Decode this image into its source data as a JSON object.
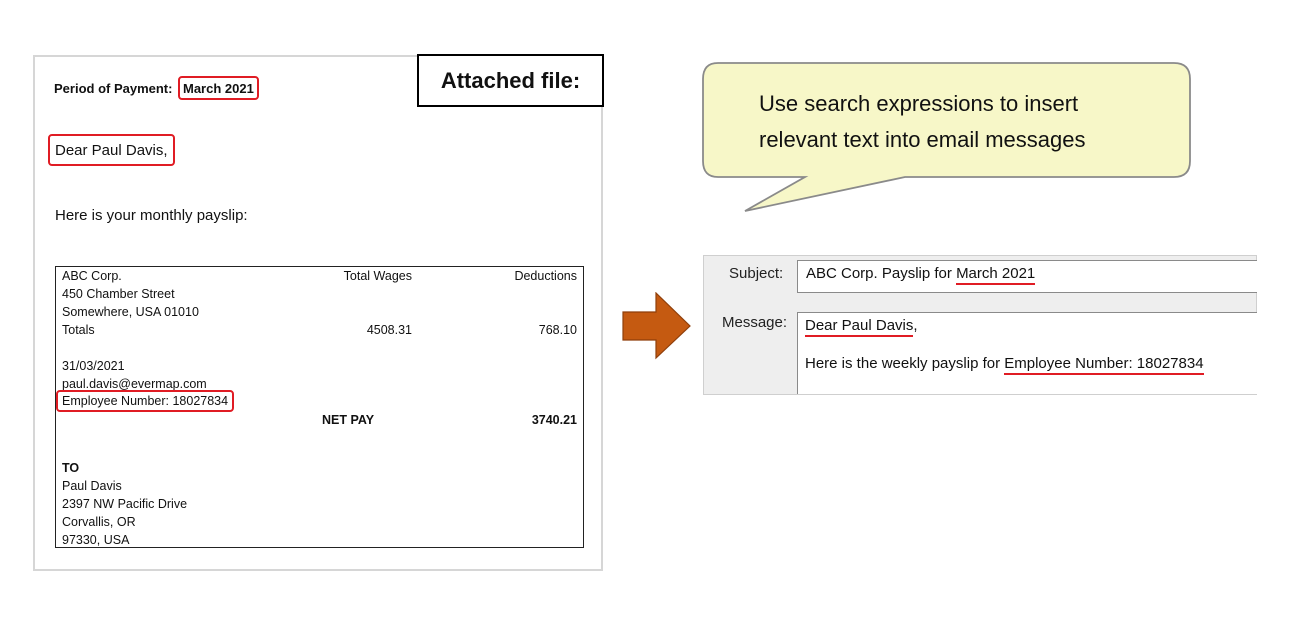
{
  "attached_label": "Attached file:",
  "document": {
    "period_label": "Period of Payment:",
    "period_value": "March 2021",
    "greeting": "Dear Paul Davis,",
    "intro": "Here is your monthly payslip:",
    "payslip": {
      "company": "ABC Corp.",
      "street": "450 Chamber Street",
      "city": "Somewhere, USA 01010",
      "totals_label": "Totals",
      "col_wages": "Total Wages",
      "col_deductions": "Deductions",
      "wages_total": "4508.31",
      "deductions_total": "768.10",
      "date": "31/03/2021",
      "email": "paul.davis@evermap.com",
      "employee_number": "Employee Number: 18027834",
      "net_pay_label": "NET PAY",
      "net_pay_value": "3740.21",
      "to_label": "TO",
      "to_name": "Paul Davis",
      "to_street": "2397 NW Pacific Drive",
      "to_city": "Corvallis, OR",
      "to_zip": "97330, USA"
    }
  },
  "callout": {
    "line1": "Use search expressions to insert",
    "line2": "relevant text into email messages"
  },
  "email": {
    "subject_label": "Subject:",
    "subject_prefix": "ABC Corp. Payslip for ",
    "subject_var": "March 2021",
    "message_label": "Message:",
    "msg_line1": "Dear Paul Davis",
    "msg_line1_suffix": ",",
    "msg_line2_prefix": "Here is the weekly payslip for ",
    "msg_line2_var": "Employee Number: 18027834"
  },
  "colors": {
    "highlight": "#e01c24",
    "arrow": "#c55a11",
    "callout_fill": "#f7f7c8"
  }
}
